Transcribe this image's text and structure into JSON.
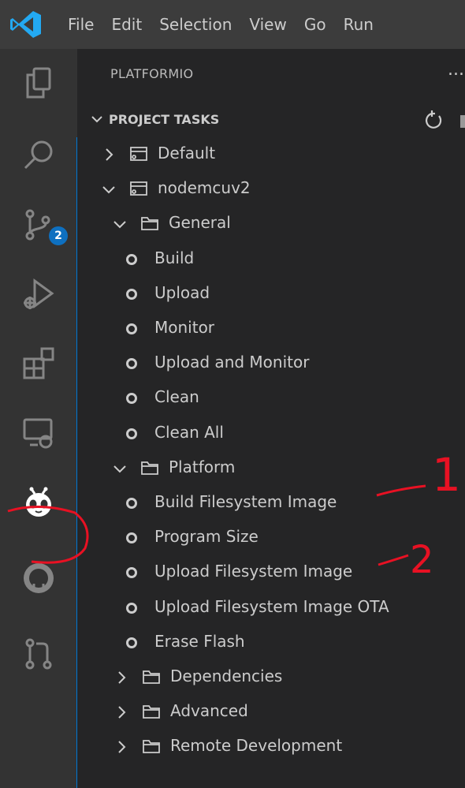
{
  "menu": [
    "File",
    "Edit",
    "Selection",
    "View",
    "Go",
    "Run"
  ],
  "activity_badge": "2",
  "sidebar": {
    "title": "PLATFORMIO",
    "more": "...",
    "section": "PROJECT TASKS"
  },
  "tree": [
    {
      "label": "Default",
      "kind": "env",
      "expanded": false
    },
    {
      "label": "nodemcuv2",
      "kind": "env",
      "expanded": true
    },
    {
      "label": "General",
      "kind": "folder",
      "expanded": true
    },
    {
      "label": "Build",
      "kind": "task"
    },
    {
      "label": "Upload",
      "kind": "task"
    },
    {
      "label": "Monitor",
      "kind": "task"
    },
    {
      "label": "Upload and Monitor",
      "kind": "task"
    },
    {
      "label": "Clean",
      "kind": "task"
    },
    {
      "label": "Clean All",
      "kind": "task"
    },
    {
      "label": "Platform",
      "kind": "folder",
      "expanded": true
    },
    {
      "label": "Build Filesystem Image",
      "kind": "task"
    },
    {
      "label": "Program Size",
      "kind": "task"
    },
    {
      "label": "Upload Filesystem Image",
      "kind": "task"
    },
    {
      "label": "Upload Filesystem Image OTA",
      "kind": "task"
    },
    {
      "label": "Erase Flash",
      "kind": "task"
    },
    {
      "label": "Dependencies",
      "kind": "folder",
      "expanded": false
    },
    {
      "label": "Advanced",
      "kind": "folder",
      "expanded": false
    },
    {
      "label": "Remote Development",
      "kind": "folder",
      "expanded": false
    }
  ],
  "annotations": [
    "1",
    "2"
  ],
  "colors": {
    "accent": "#0078d4",
    "annotation": "#e81123",
    "badge": "#0e70c0"
  }
}
